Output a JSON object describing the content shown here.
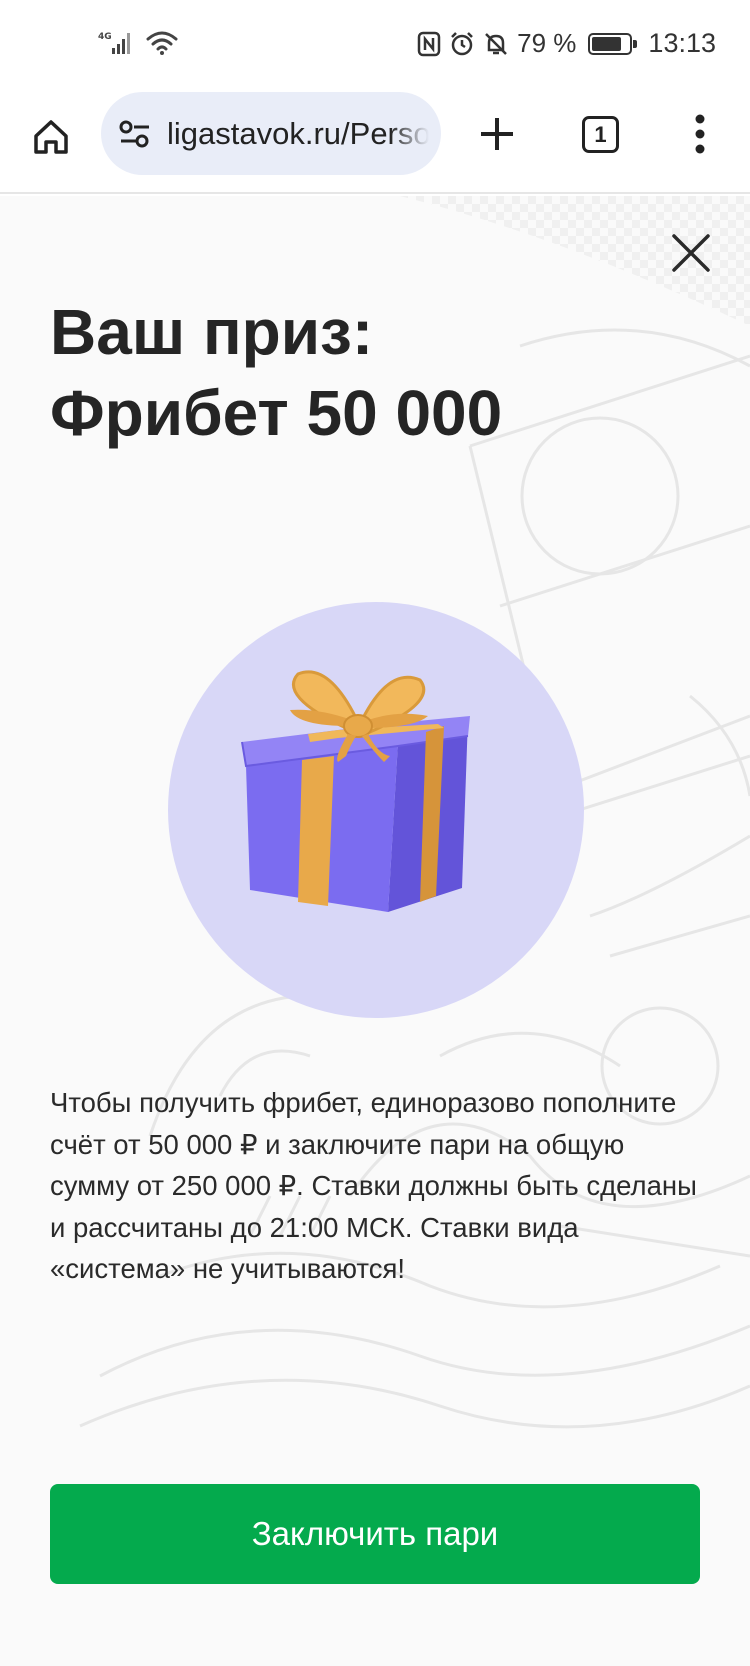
{
  "status_bar": {
    "network": "4G",
    "battery_percent": "79 %",
    "battery_level": 0.79,
    "time": "13:13",
    "icons": [
      "signal-icon",
      "wifi-icon",
      "nfc-icon",
      "alarm-icon",
      "mute-icon",
      "battery-icon"
    ]
  },
  "browser": {
    "url": "ligastavok.ru/Personal",
    "tab_count": "1",
    "icons": [
      "home-icon",
      "site-settings-icon",
      "plus-icon",
      "more-vert-icon"
    ]
  },
  "prize": {
    "title_line1": "Ваш приз:",
    "title_line2": "Фрибет 50 000",
    "description": "Чтобы получить фрибет, единоразово пополните счёт от 50 000 ₽ и заключите пари на общую сумму от 250 000 ₽. Ставки должны быть сделаны и рассчитаны до 21:00 МСК. Ставки вида «система» не учитываются!",
    "button_label": "Заключить пари"
  },
  "colors": {
    "accent_green": "#04aa4d",
    "circle_lavender": "#d8d7f7",
    "gift_purple": "#7b6cf0",
    "ribbon_gold": "#e8a94a"
  }
}
